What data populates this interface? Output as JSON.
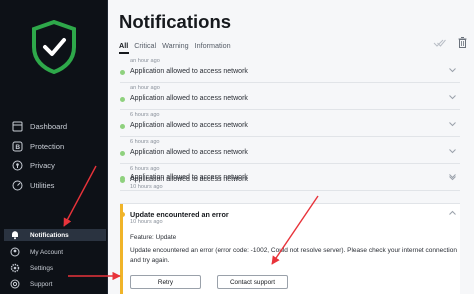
{
  "sidebar": {
    "main_items": [
      {
        "label": "Dashboard",
        "icon": "dashboard-icon"
      },
      {
        "label": "Protection",
        "icon": "protection-icon"
      },
      {
        "label": "Privacy",
        "icon": "privacy-icon"
      },
      {
        "label": "Utilities",
        "icon": "utilities-icon"
      }
    ],
    "bottom_items": [
      {
        "label": "Notifications",
        "icon": "bell-icon",
        "active": true
      },
      {
        "label": "My Account",
        "icon": "account-icon"
      },
      {
        "label": "Settings",
        "icon": "gear-icon"
      },
      {
        "label": "Support",
        "icon": "support-icon"
      }
    ]
  },
  "page": {
    "title": "Notifications",
    "tabs": [
      {
        "label": "All",
        "active": true
      },
      {
        "label": "Critical"
      },
      {
        "label": "Warning"
      },
      {
        "label": "Information"
      }
    ]
  },
  "notifications": [
    {
      "title": "Application allowed to access network",
      "time": "an hour ago"
    },
    {
      "title": "Application allowed to access network",
      "time": "an hour ago"
    },
    {
      "title": "Application allowed to access network",
      "time": "6 hours ago"
    },
    {
      "title": "Application allowed to access network",
      "time": "6 hours ago"
    },
    {
      "title": "Application allowed to access network",
      "time": "6 hours ago"
    },
    {
      "title": "Application allowed to access network",
      "time": "10 hours ago"
    }
  ],
  "error": {
    "title": "Update encountered an error",
    "time": "10 hours ago",
    "feature": "Feature: Update",
    "message": "Update encountered an error (error code: -1002, Could not resolve server). Please check your internet connection and try again.",
    "retry_label": "Retry",
    "contact_label": "Contact support"
  },
  "colors": {
    "sidebar_bg": "#0d1117",
    "logo_green": "#2ea84a",
    "success_dot": "#8fd17e",
    "warning": "#f0b429",
    "annotation_red": "#e8333a"
  }
}
